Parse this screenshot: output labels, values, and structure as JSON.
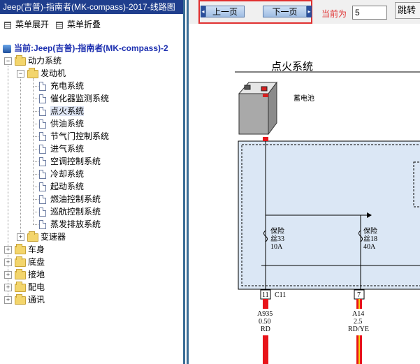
{
  "window": {
    "title": "Jeep(吉普)-指南者(MK-compass)-2017-线路图"
  },
  "menu": {
    "expand_label": "菜单展开",
    "collapse_label": "菜单折叠"
  },
  "tree": {
    "current_label": "当前:Jeep(吉普)-指南者(MK-compass)-2",
    "power": "动力系统",
    "engine": "发动机",
    "engine_items": [
      "充电系统",
      "催化器监测系统",
      "点火系统",
      "供油系统",
      "节气门控制系统",
      "进气系统",
      "空调控制系统",
      "冷却系统",
      "起动系统",
      "燃油控制系统",
      "巡航控制系统",
      "蒸发排放系统"
    ],
    "selected_item": "点火系统",
    "transmission": "变速器",
    "top_items": [
      "车身",
      "底盘",
      "接地",
      "配电",
      "通讯"
    ]
  },
  "toolbar": {
    "prev_label": "上一页",
    "next_label": "下一页",
    "current_label": "当前为",
    "page_value": "5",
    "jump_label": "跳转"
  },
  "diagram": {
    "title": "点火系统",
    "battery_label": "蓄电池",
    "fuse1": {
      "l1": "保险",
      "l2": "丝33",
      "l3": "10A"
    },
    "fuse2": {
      "l1": "保险",
      "l2": "丝18",
      "l3": "40A"
    },
    "pin1": "11",
    "connector": "C11",
    "pin2": "7",
    "wire1": {
      "id": "A935",
      "gauge": "0.50",
      "color": "RD"
    },
    "wire2": {
      "id": "A14",
      "gauge": "2.5",
      "color": "RD/YE"
    }
  },
  "colors": {
    "titlebar": "#1f3e8d",
    "splitter": "#3b6e97",
    "highlight_red": "#e03030",
    "fuse_box": "#dbe7f5",
    "wire_red": "#e8141a",
    "wire_yellow": "#f2d20c"
  }
}
